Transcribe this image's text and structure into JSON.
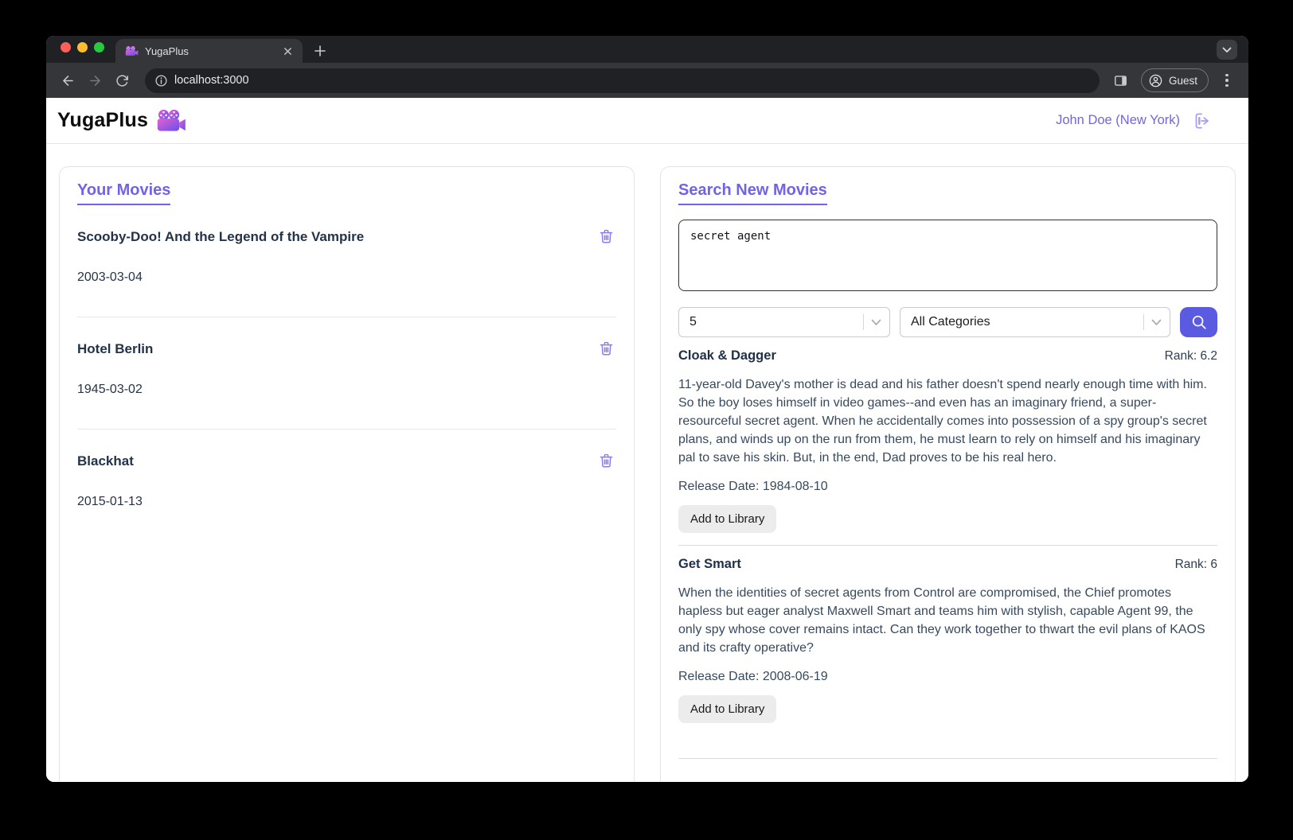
{
  "browser": {
    "tab_title": "YugaPlus",
    "address": "localhost:3000",
    "profile_label": "Guest"
  },
  "header": {
    "app_name": "YugaPlus",
    "user": "John Doe (New York)"
  },
  "library": {
    "title": "Your Movies",
    "movies": [
      {
        "title": "Scooby-Doo! And the Legend of the Vampire",
        "date": "2003-03-04"
      },
      {
        "title": "Hotel Berlin",
        "date": "1945-03-02"
      },
      {
        "title": "Blackhat",
        "date": "2015-01-13"
      }
    ]
  },
  "search": {
    "title": "Search New Movies",
    "query": "secret agent",
    "limit_value": "5",
    "category_value": "All Categories",
    "results": [
      {
        "title": "Cloak & Dagger",
        "rank": "Rank: 6.2",
        "description": "11-year-old Davey's mother is dead and his father doesn't spend nearly enough time with him. So the boy loses himself in video games--and even has an imaginary friend, a super-resourceful secret agent. When he accidentally comes into possession of a spy group's secret plans, and winds up on the run from them, he must learn to rely on himself and his imaginary pal to save his skin. But, in the end, Dad proves to be his real hero.",
        "release": "Release Date: 1984-08-10",
        "add_label": "Add to Library"
      },
      {
        "title": "Get Smart",
        "rank": "Rank: 6",
        "description": "When the identities of secret agents from Control are compromised, the Chief promotes hapless but eager analyst Maxwell Smart and teams him with stylish, capable Agent 99, the only spy whose cover remains intact. Can they work together to thwart the evil plans of KAOS and its crafty operative?",
        "release": "Release Date: 2008-06-19",
        "add_label": "Add to Library"
      }
    ]
  },
  "colors": {
    "accent_purple": "#7163e8",
    "user_link_purple": "#7366d6",
    "search_button": "#5a5be0",
    "traffic_red": "#ff5f57",
    "traffic_yellow": "#febc2e",
    "traffic_green": "#28c840",
    "browser_dark": "#202124",
    "toolbar_dark": "#35363a"
  }
}
